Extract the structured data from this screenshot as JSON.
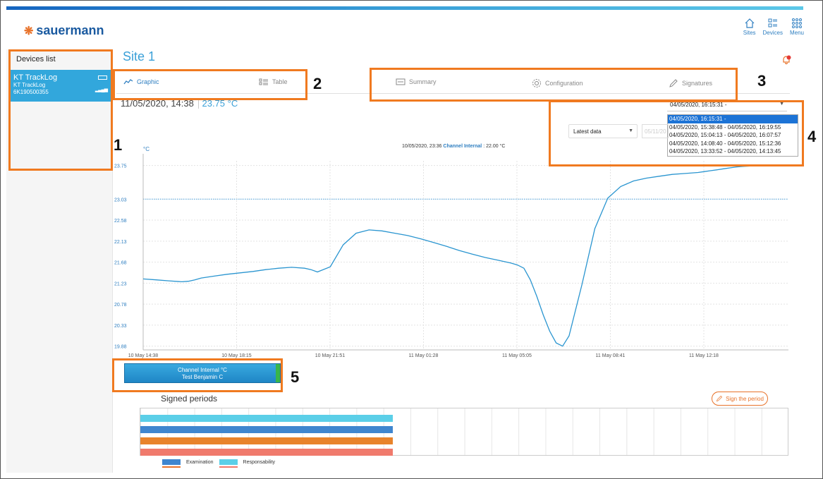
{
  "brand": {
    "name": "sauermann",
    "color": "#1a5aa0",
    "accent": "#e8732b"
  },
  "nav": [
    {
      "label": "Sites",
      "icon": "home-icon"
    },
    {
      "label": "Devices",
      "icon": "devices-list-icon"
    },
    {
      "label": "Menu",
      "icon": "grid-menu-icon"
    }
  ],
  "sidebar": {
    "title": "Devices list",
    "device": {
      "name": "KT TrackLog",
      "model": "KT TrackLog",
      "serial": "6K190500355"
    }
  },
  "site": {
    "title": "Site 1"
  },
  "tabs": {
    "graphic": "Graphic",
    "table": "Table",
    "summary": "Summary",
    "configuration": "Configuration",
    "signatures": "Signatures"
  },
  "reading": {
    "datetime": "11/05/2020, 14:38",
    "value": "23.75 °C"
  },
  "period": {
    "selected": "04/05/2020, 16:15:31 -",
    "options": [
      "04/05/2020, 16:15:31 -",
      "04/05/2020, 15:38:48 - 04/05/2020, 16:19:55",
      "04/05/2020, 15:04:13 - 04/05/2020, 16:07:57",
      "04/05/2020, 14:08:40 - 04/05/2020, 15:12:36",
      "04/05/2020, 13:33:52 - 04/05/2020, 14:13:45"
    ]
  },
  "filter": {
    "latest_label": "Latest data",
    "date_partial": "05/11/20"
  },
  "chart_info": {
    "datetime": "10/05/2020, 23:36",
    "channel": "Channel Internal",
    "value": ": 22.00 °C"
  },
  "chart_data": {
    "type": "line",
    "ylabel": "°C",
    "yticks": [
      "23.75",
      "23.03",
      "22.58",
      "22.13",
      "21.68",
      "21.23",
      "20.78",
      "20.33",
      "19.88"
    ],
    "xticks": [
      "10 May 14:38",
      "10 May 18:15",
      "10 May 21:51",
      "11 May 01:28",
      "11 May 05:05",
      "11 May 08:41",
      "11 May 12:18"
    ],
    "ylim": [
      19.8,
      23.85
    ],
    "reference_line": 23.03,
    "x": [
      0,
      2,
      4,
      6,
      7,
      8,
      9,
      11,
      13,
      15,
      17,
      19,
      21,
      23,
      25,
      26,
      27,
      29,
      31,
      33,
      35,
      37,
      39,
      41,
      43,
      45,
      47,
      49,
      51,
      53,
      55,
      56,
      57,
      58,
      59,
      60,
      61,
      62,
      63,
      64,
      65,
      66,
      68,
      70,
      72,
      74,
      76,
      78,
      80,
      82,
      84,
      86,
      87,
      88,
      89,
      90,
      91,
      92,
      93,
      94,
      95,
      96,
      97,
      98,
      99,
      100
    ],
    "values": [
      21.32,
      21.3,
      21.28,
      21.26,
      21.27,
      21.3,
      21.34,
      21.38,
      21.42,
      21.45,
      21.48,
      21.52,
      21.55,
      21.57,
      21.55,
      21.52,
      21.47,
      21.58,
      22.05,
      22.3,
      22.37,
      22.35,
      22.3,
      22.25,
      22.18,
      22.1,
      22.02,
      21.93,
      21.85,
      21.78,
      21.72,
      21.69,
      21.66,
      21.62,
      21.55,
      21.3,
      20.95,
      20.55,
      20.2,
      19.95,
      19.88,
      20.1,
      21.2,
      22.4,
      23.05,
      23.3,
      23.42,
      23.48,
      23.52,
      23.56,
      23.58,
      23.6,
      23.62,
      23.64,
      23.66,
      23.68,
      23.7,
      23.72,
      23.73,
      23.74,
      23.75,
      23.75,
      23.76,
      23.76,
      23.75,
      23.75
    ],
    "color": "#2a95d0"
  },
  "channel_card": {
    "line1": "Channel Internal °C",
    "line2": "Test Benjamin C"
  },
  "signed": {
    "title": "Signed periods",
    "button": "Sign the period",
    "bars": [
      "#5bcfe8",
      "#3f86cf",
      "#e8832b",
      "#f07a6c"
    ],
    "legend": [
      {
        "label": "Examination",
        "color": "#3f86cf"
      },
      {
        "label": "Responsability",
        "color": "#5bcfe8"
      }
    ]
  },
  "annotations": [
    "1",
    "2",
    "3",
    "4",
    "5"
  ]
}
